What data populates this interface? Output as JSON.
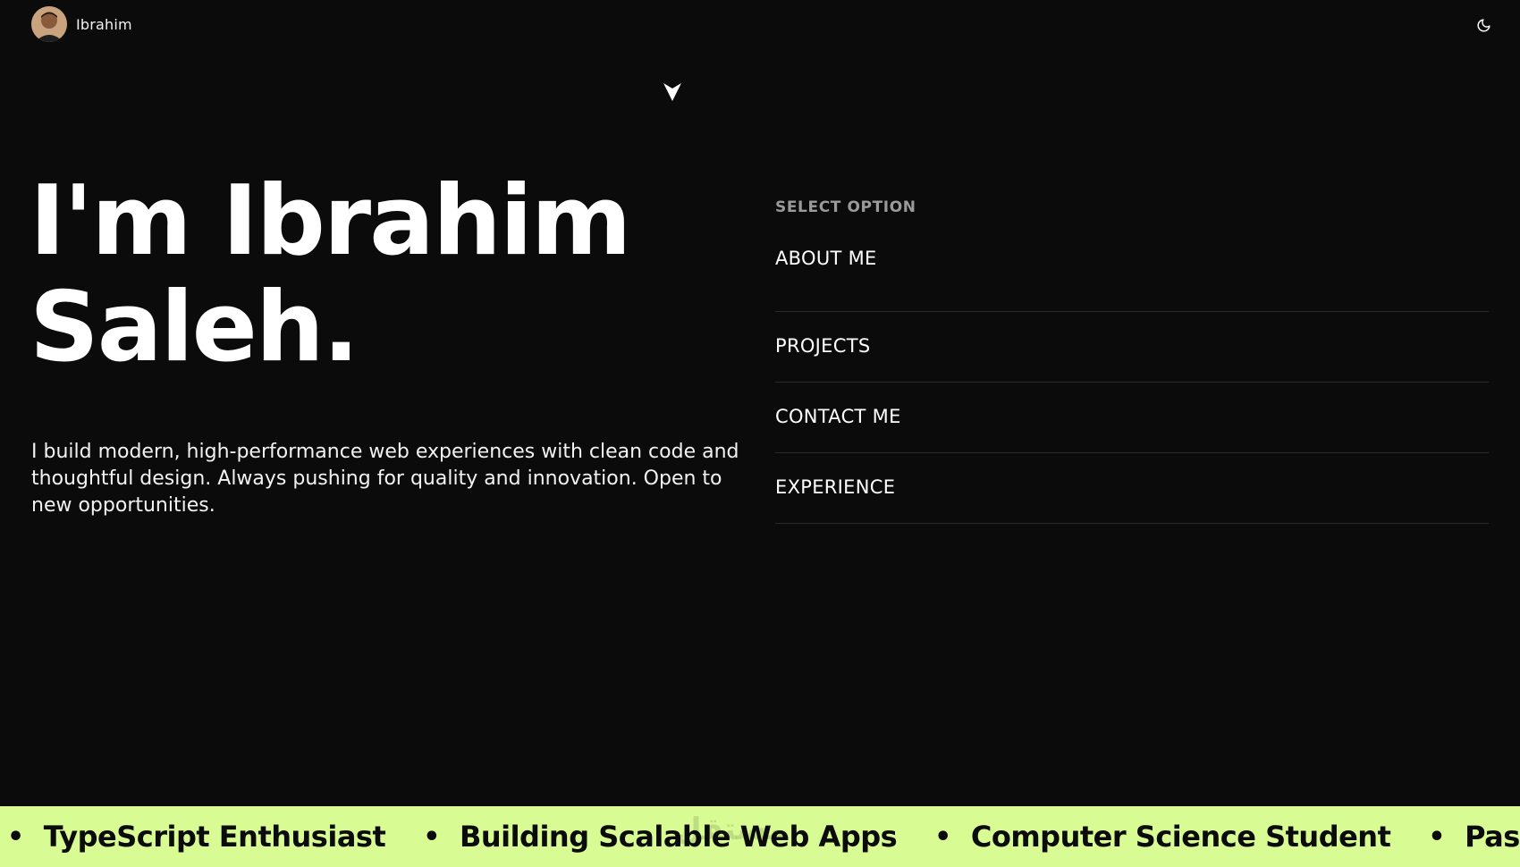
{
  "header": {
    "name": "Ibrahim",
    "theme_toggle_icon": "moon-icon"
  },
  "hero": {
    "title_line1": "I'm Ibrahim",
    "title_line2": "Saleh.",
    "description": "I build modern, high-performance web experiences with clean code and\n thoughtful design. Always pushing for quality and innovation. Open to\nnew opportunities."
  },
  "menu": {
    "heading": "SELECT OPTION",
    "items": [
      {
        "label": "ABOUT ME"
      },
      {
        "label": "PROJECTS"
      },
      {
        "label": "CONTACT ME"
      },
      {
        "label": "EXPERIENCE"
      }
    ]
  },
  "marquee": {
    "bullet": "•",
    "items": [
      {
        "text": "TypeScript Enthusiast"
      },
      {
        "text": "Building Scalable Web Apps"
      },
      {
        "text": "Computer Science Student"
      },
      {
        "text": "Passion"
      }
    ],
    "watermark": "مستقل"
  },
  "colors": {
    "background": "#0b0b0b",
    "accent": "#d9fb93",
    "muted_heading": "#9a9a9a",
    "divider": "#2a2a2a"
  }
}
